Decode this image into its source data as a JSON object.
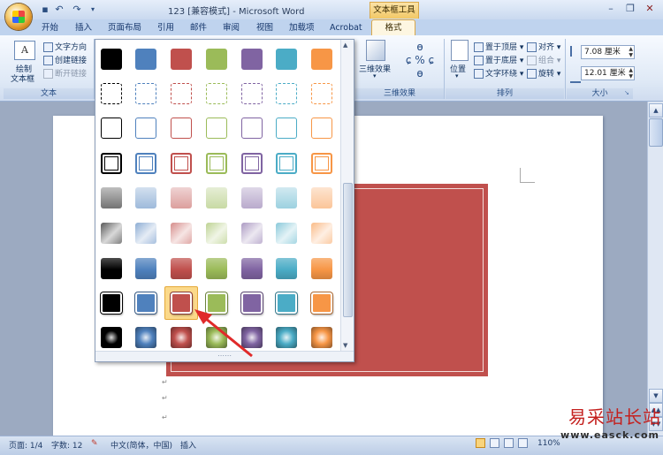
{
  "window": {
    "title": "123 [兼容模式] - Microsoft Word",
    "context_tab_group": "文本框工具",
    "quick_access": [
      "save-icon",
      "undo-icon",
      "redo-icon"
    ],
    "controls": [
      "minimize-icon",
      "restore-icon",
      "close-icon"
    ]
  },
  "tabs": {
    "home": "开始",
    "insert": "插入",
    "layout": "页面布局",
    "references": "引用",
    "mailings": "邮件",
    "review": "审阅",
    "view": "视图",
    "addins": "加载项",
    "acrobat": "Acrobat",
    "format": "格式"
  },
  "ribbon": {
    "text_group": {
      "label": "文本",
      "draw_textbox_line1": "绘制",
      "draw_textbox_line2": "文本框",
      "text_direction": "文字方向",
      "create_link": "创建链接",
      "break_link": "断开链接"
    },
    "threed_group": {
      "label": "三维效果",
      "button": "三维效果"
    },
    "arrange_group": {
      "label": "排列",
      "position": "位置",
      "bring_front": "置于顶层",
      "send_back": "置于底层",
      "text_wrap": "文字环绕",
      "align": "对齐",
      "group": "组合",
      "rotate": "旋转"
    },
    "size_group": {
      "label": "大小",
      "height": "7.08 厘米",
      "width": "12.01 厘米"
    }
  },
  "gallery": {
    "colors": [
      "#000000",
      "#4f81bd",
      "#c0504d",
      "#9bbb59",
      "#8064a2",
      "#4bacc6",
      "#f79646"
    ],
    "styles": [
      "solid",
      "dashed-outline",
      "thin-outline",
      "thick-outline",
      "light-gradient",
      "light-gradient-2",
      "moderate",
      "intense",
      "radial"
    ],
    "selected_row": 7,
    "selected_col": 2
  },
  "status": {
    "page": "页面: 1/4",
    "words": "字数: 12",
    "language": "中文(简体，中国)",
    "mode": "插入",
    "zoom": "110%"
  },
  "watermark": {
    "line1": "易采站长站",
    "line2": "www.easck.com"
  }
}
